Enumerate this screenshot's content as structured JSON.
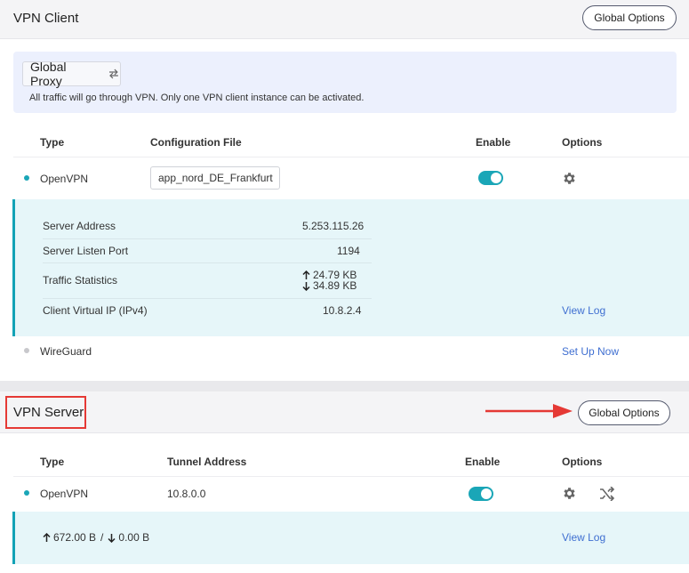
{
  "vpn_client": {
    "title": "VPN Client",
    "global_options_label": "Global Options",
    "global_proxy": {
      "label": "Global Proxy",
      "description": "All traffic will go through VPN. Only one VPN client instance can be activated."
    },
    "columns": {
      "type": "Type",
      "config": "Configuration File",
      "enable": "Enable",
      "options": "Options"
    },
    "openvpn": {
      "type": "OpenVPN",
      "config_file": "app_nord_DE_Frankfurt",
      "enabled": true,
      "details": {
        "server_address_label": "Server Address",
        "server_address": "5.253.115.26",
        "listen_port_label": "Server Listen Port",
        "listen_port": "1194",
        "traffic_label": "Traffic Statistics",
        "upload": "24.79 KB",
        "download": "34.89 KB",
        "virtual_ip_label": "Client Virtual IP (IPv4)",
        "virtual_ip": "10.8.2.4",
        "view_log": "View Log"
      }
    },
    "wireguard": {
      "type": "WireGuard",
      "action": "Set Up Now"
    }
  },
  "vpn_server": {
    "title": "VPN Server",
    "global_options_label": "Global Options",
    "columns": {
      "type": "Type",
      "tunnel": "Tunnel Address",
      "enable": "Enable",
      "options": "Options"
    },
    "openvpn": {
      "type": "OpenVPN",
      "tunnel_address": "10.8.0.0",
      "enabled": true,
      "upload": "672.00 B",
      "separator": "/",
      "download": "0.00 B",
      "view_log": "View Log"
    }
  },
  "colors": {
    "accent": "#1aa6b7",
    "link": "#3f6fd1",
    "highlight": "#e53935"
  }
}
